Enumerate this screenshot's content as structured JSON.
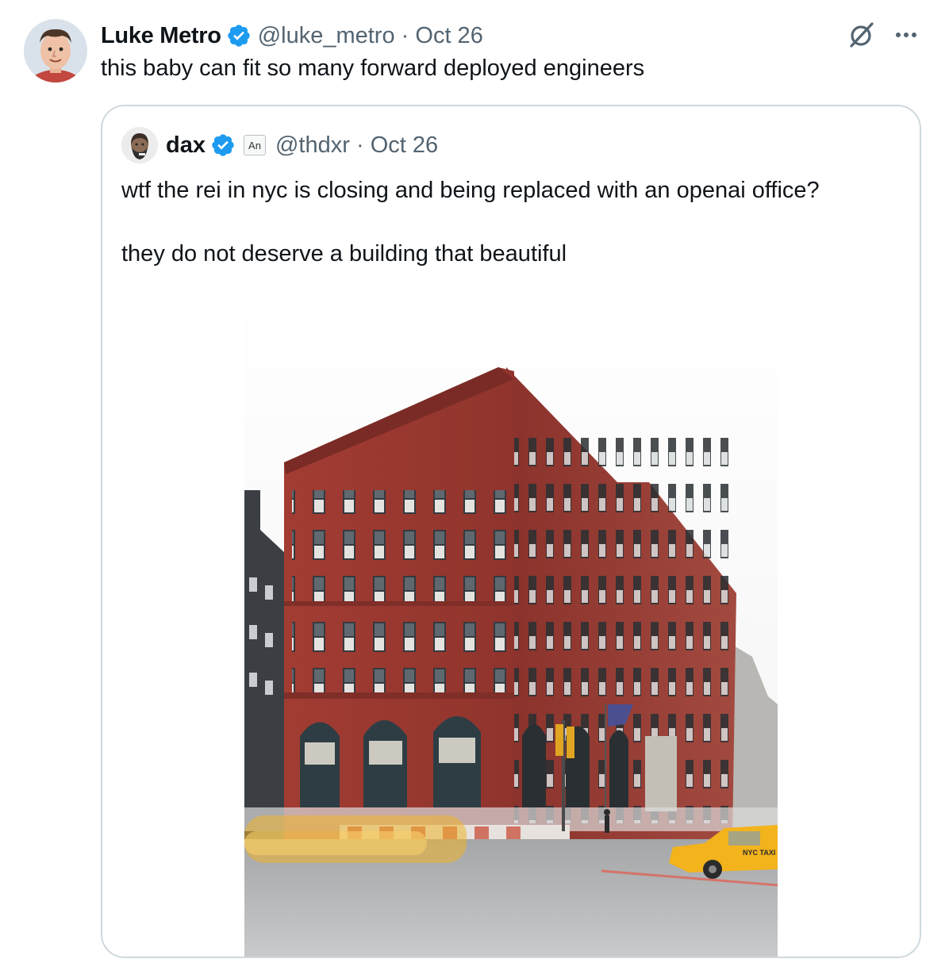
{
  "tweet": {
    "author_name": "Luke Metro",
    "handle": "@luke_metro",
    "date": "Oct 26",
    "text": "this baby can fit so many forward deployed engineers",
    "verified_icon": "verified-badge-icon",
    "grok_icon": "grok-icon",
    "more_icon": "more-options-icon"
  },
  "quote": {
    "author_name": "dax",
    "affiliate_label": "An",
    "handle": "@thdxr",
    "date": "Oct 26",
    "text_line1": "wtf the rei in nyc is closing and being replaced with an openai office?",
    "text_line2": "they do not deserve a building that beautiful",
    "media_description_icon": "building-photo",
    "taxi_sign": "NYC TAXI"
  },
  "separator": "·",
  "colors": {
    "verified": "#1d9bf0",
    "secondary_text": "#536471",
    "border": "#cfd9de",
    "brick": "#9a3a33",
    "taxi": "#f2b31c"
  }
}
